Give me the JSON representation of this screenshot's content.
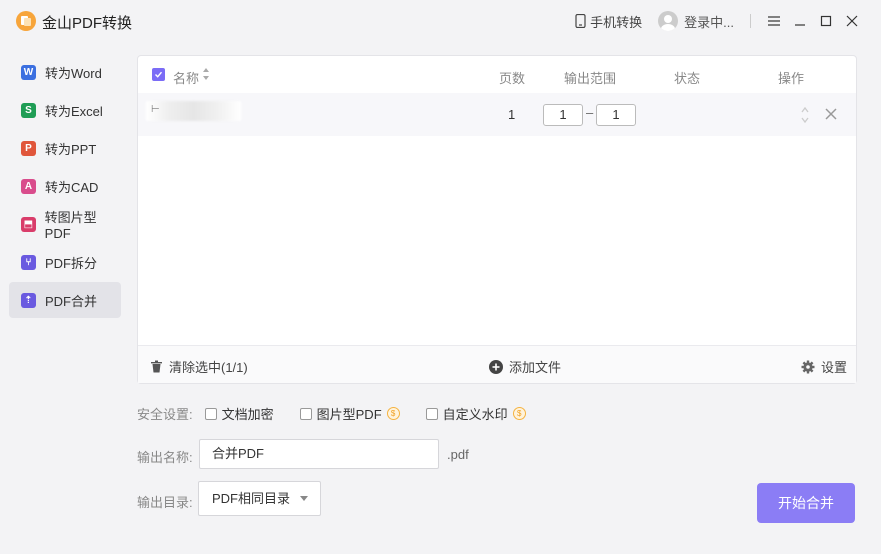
{
  "app": {
    "title": "金山PDF转换"
  },
  "titlebar": {
    "phone_label": "手机转换",
    "user_label": "登录中..."
  },
  "sidebar": {
    "items": [
      {
        "label": "转为Word",
        "icon": "W",
        "color": "#3b6fe0"
      },
      {
        "label": "转为Excel",
        "icon": "S",
        "color": "#1f9d55"
      },
      {
        "label": "转为PPT",
        "icon": "P",
        "color": "#e0563b"
      },
      {
        "label": "转为CAD",
        "icon": "A",
        "color": "#d94c8c"
      },
      {
        "label": "转图片型PDF",
        "icon": "⬒",
        "color": "#d93c6a"
      },
      {
        "label": "PDF拆分",
        "icon": "⑂",
        "color": "#6a5ae0"
      },
      {
        "label": "PDF合并",
        "icon": "⇡",
        "color": "#6a5ae0"
      }
    ],
    "active_index": 6
  },
  "table": {
    "headers": {
      "name": "名称",
      "pages": "页数",
      "range": "输出范围",
      "status": "状态",
      "action": "操作"
    },
    "rows": [
      {
        "pages": "1",
        "range_from": "1",
        "range_to": "1",
        "range_sep": "–",
        "name_mark": "⊢"
      }
    ]
  },
  "panel_footer": {
    "clear": "清除选中(1/1)",
    "add": "添加文件",
    "settings": "设置"
  },
  "options": {
    "security_label": "安全设置:",
    "encrypt": "文档加密",
    "image_pdf": "图片型PDF",
    "watermark": "自定义水印"
  },
  "output": {
    "name_label": "输出名称:",
    "name_value": "合并PDF",
    "ext": ".pdf",
    "dir_label": "输出目录:",
    "dir_value": "PDF相同目录"
  },
  "start_button": "开始合并",
  "colors": {
    "accent": "#8b7df5",
    "checkbox": "#7b6cf6",
    "vip": "#f0a020"
  }
}
